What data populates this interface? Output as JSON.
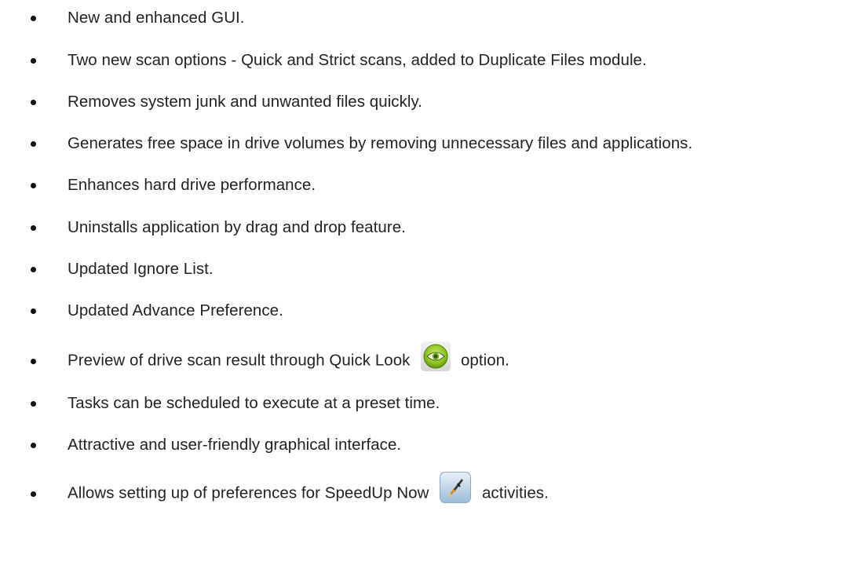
{
  "features": [
    {
      "text": "New and enhanced GUI."
    },
    {
      "text": "Two new scan options - Quick and Strict scans, added to Duplicate Files module."
    },
    {
      "text": "Removes system junk and unwanted files quickly."
    },
    {
      "text": "Generates free space in drive volumes by removing unnecessary files and applications."
    },
    {
      "text": "Enhances hard drive performance."
    },
    {
      "text": "Uninstalls application by drag and drop feature."
    },
    {
      "text": "Updated Ignore List."
    },
    {
      "text": "Updated Advance Preference."
    },
    {
      "text_before": "Preview of drive scan result through Quick Look",
      "icon": "quick-look-eye-icon",
      "text_after": "option."
    },
    {
      "text": "Tasks can be scheduled to execute at a preset time."
    },
    {
      "text": "Attractive and user-friendly graphical interface."
    },
    {
      "text_before": "Allows setting up of preferences for SpeedUp Now",
      "icon": "speedup-now-icon",
      "text_after": "activities."
    }
  ]
}
